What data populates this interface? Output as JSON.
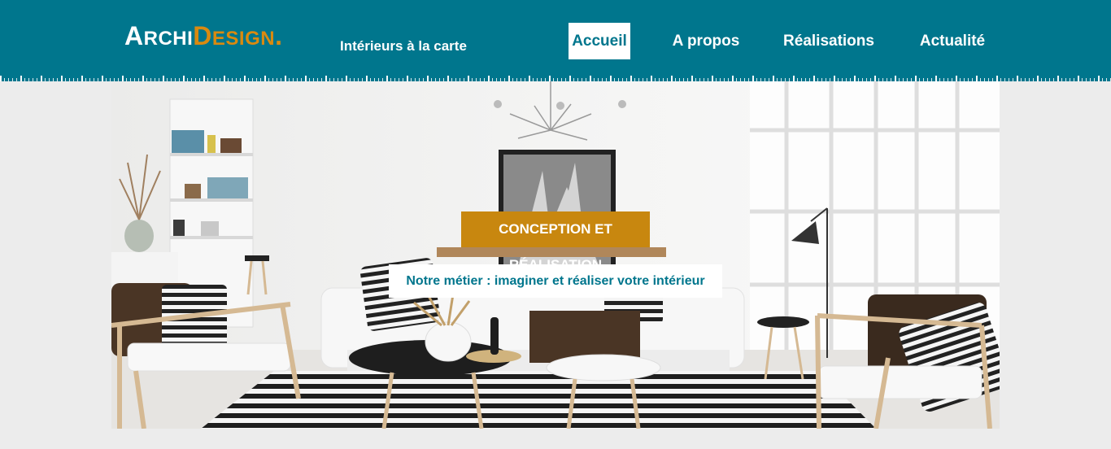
{
  "logo": {
    "first_initial": "A",
    "first_rest": "RCHI",
    "second_initial": "D",
    "second_rest": "ESIGN",
    "dot": ".",
    "tagline": "Intérieurs à la carte"
  },
  "nav": {
    "items": [
      {
        "label": "Accueil",
        "active": true
      },
      {
        "label": "A propos",
        "active": false
      },
      {
        "label": "Réalisations",
        "active": false
      },
      {
        "label": "Actualité",
        "active": false
      }
    ]
  },
  "hero": {
    "badge": "CONCEPTION ET RÉALISATION",
    "subtitle": "Notre métier : imaginer et réaliser votre intérieur"
  },
  "colors": {
    "header": "#00768d",
    "accent": "#c8870f",
    "background": "#ececec"
  }
}
